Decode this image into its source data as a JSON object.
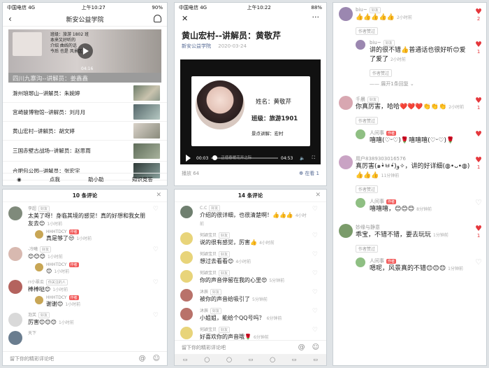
{
  "panel1": {
    "status": {
      "carrier": "中国电信  4G",
      "time": "上午10:27",
      "battery": "90%"
    },
    "title": "新安公益学院",
    "video": {
      "note_lines": [
        "班级：旅游 1802 班",
        "本来又好听的",
        "介绍 曲线的话",
        "今后 也是 风景区"
      ],
      "time": "04:16"
    },
    "lead_caption": "四川九寨沟--讲解员：姜鑫鑫",
    "items": [
      "滁州琅琊山--讲解员：朱婉婷",
      "宫崎骏博物馆--讲解员：刘月月",
      "黄山宏村--讲解员：胡文婷",
      "三国赤壁古战场--讲解员：赵思雨",
      "合肥包公园--讲解员：张宏宇"
    ],
    "tabs": [
      "◉",
      "点我",
      "助小助",
      "知识竞答"
    ]
  },
  "panel2": {
    "status": {
      "carrier": "中国电信  4G",
      "time": "上午10:22",
      "battery": "88%"
    },
    "title": "黄山宏村--讲解员：黄敬芹",
    "author": "新安公益学院",
    "date": "2020-03-24",
    "video": {
      "name_label": "姓名：黄敬芹",
      "class_label": "班级：旅游1901",
      "spot_label": "景点讲解：宏村",
      "current": "00:03",
      "total": "04:53",
      "subtitle": "正值春暖花开之际"
    },
    "views": "播放 64",
    "watching": "在看 1"
  },
  "comments1": {
    "header": "10 条评论",
    "comments": [
      {
        "name": "李超",
        "tag": "好友",
        "text": "太美了呀！身临其境的感觉！真的好想和我女朋友去😊",
        "time": "1小时前",
        "replies": [
          {
            "name": "HHHTDCY",
            "tag": "作者",
            "text": "真是够了😒",
            "time": "1小时前"
          }
        ]
      },
      {
        "name": "-冷曦",
        "tag": "好友",
        "text": "😊😊😊",
        "time": "1小时前",
        "replies": [
          {
            "name": "HHHTDCY",
            "tag": "作者",
            "text": "😊",
            "time": "1小时前"
          }
        ]
      },
      {
        "name": "rr小翠瓜",
        "tag": "你关注的人",
        "text": "棒棒哒😊",
        "time": "1小时前",
        "replies": [
          {
            "name": "HHHTDCY",
            "tag": "作者",
            "text": "谢谢😊",
            "time": "1小时前"
          }
        ]
      },
      {
        "name": "泡芙",
        "tag": "好友",
        "text": "厉害😊😊😊",
        "time": "1小时前",
        "replies": []
      },
      {
        "name": "天下",
        "tag": "",
        "text": "",
        "time": "",
        "replies": []
      }
    ],
    "input_placeholder": "留下你的精彩评论吧"
  },
  "comments2": {
    "header": "14 条评论",
    "comments": [
      {
        "name": "C.C",
        "tag": "好友",
        "text": "介绍的很详细，也很清楚啊！👍👍👍",
        "time": "4小时前"
      },
      {
        "name": "何颖宝贝",
        "tag": "好友",
        "text": "说的很有感觉，厉害👍",
        "time": "4小时前"
      },
      {
        "name": "何颖宝贝",
        "tag": "好友",
        "text": "想过去看看😊",
        "time": "4小时前"
      },
      {
        "name": "何颖宝贝",
        "tag": "好友",
        "text": "你的声音停留在我的心里😍",
        "time": "5分钟前"
      },
      {
        "name": "沐辰",
        "tag": "好友",
        "text": "被你的声音给吸引了",
        "time": "5分钟前"
      },
      {
        "name": "沐辰",
        "tag": "好友",
        "text": "小姐姐，能给个QQ号吗？",
        "time": "6分钟前"
      },
      {
        "name": "何颖宝贝",
        "tag": "好友",
        "text": "好喜欢你的声音哦🌹",
        "time": "6分钟前"
      }
    ],
    "input_placeholder": "留下你的精彩评论吧"
  },
  "comments3": {
    "items": [
      {
        "name": "biu~",
        "tag": "好友",
        "text": "👍👍👍👍👍",
        "time": "2小时前",
        "likes": "2",
        "liked_pill": "作者赞过",
        "replies": [
          {
            "name": "biu~",
            "tag": "好友",
            "text": "讲的很不错👍普通话也很好听😊爱了爱了",
            "time": "2小时前",
            "likes": "1",
            "liked_pill": "作者赞过"
          }
        ],
        "more": "展开1条回复"
      },
      {
        "name": "千晨",
        "tag": "好友",
        "text": "你真厉害，哈哈❤️❤️❤️👏👏👏",
        "time": "2小时前",
        "likes": "1",
        "liked_pill": "作者赞过",
        "replies": [
          {
            "name": "人间事",
            "tag": "作者",
            "text": "嘻嘻(♡ᵕ♡)🌹嘻嘻嘻(♡ᵕ♡)🌹",
            "time": "",
            "likes": "",
            "liked_pill": ""
          }
        ],
        "more": ""
      },
      {
        "name": "用户8389303016576",
        "tag": "",
        "text": "真厉害(๑•̀ㅂ•́)و✧，讲的好详细(◍•ᴗ•◍)👍👍👍",
        "time": "11分钟前",
        "likes": "1",
        "liked_pill": "作者赞过",
        "replies": [
          {
            "name": "人间事",
            "tag": "作者",
            "text": "嘻嘻嘻，😊😊😊",
            "time": "8分钟前",
            "likes": "",
            "liked_pill": ""
          }
        ],
        "more": ""
      },
      {
        "name": "妙缘与静意",
        "tag": "",
        "text": "乖宝，不错不错，要去玩玩",
        "time": "1分钟前",
        "likes": "1",
        "liked_pill": "作者赞过",
        "replies": [
          {
            "name": "人间事",
            "tag": "作者",
            "text": "嗯呢，风景真的不错😊😊😊",
            "time": "1分钟前",
            "likes": "",
            "liked_pill": ""
          }
        ],
        "more": ""
      }
    ]
  }
}
